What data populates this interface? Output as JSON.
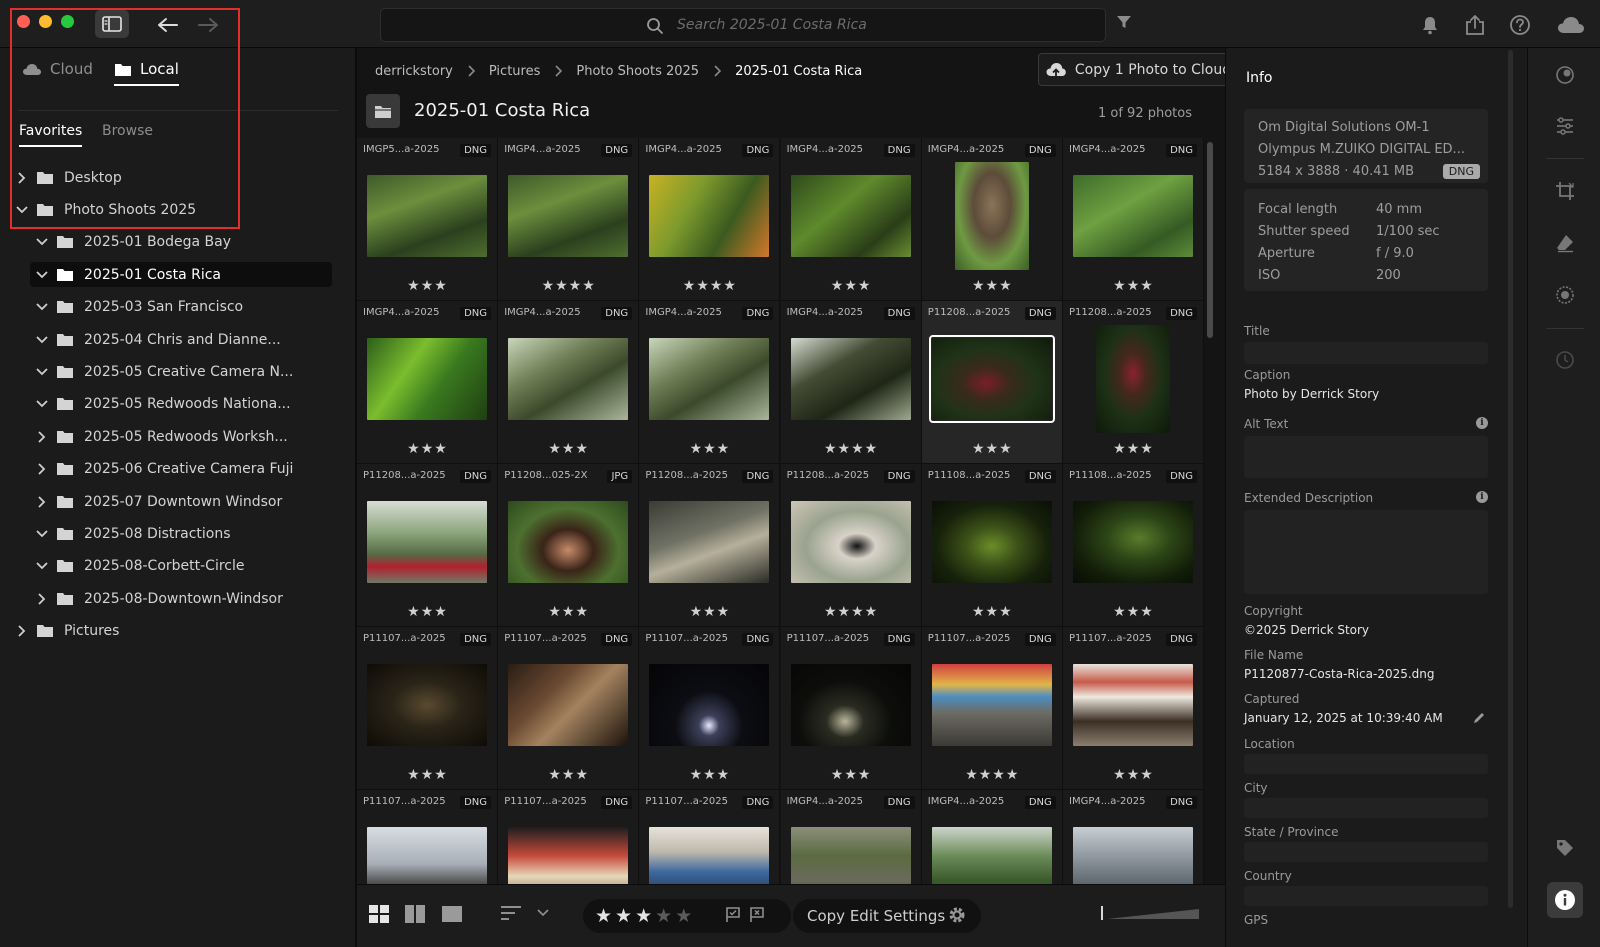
{
  "search": {
    "placeholder": "Search 2025-01 Costa Rica"
  },
  "left_panel": {
    "source_tabs": [
      {
        "label": "Cloud"
      },
      {
        "label": "Local"
      }
    ],
    "sub_tabs": [
      {
        "label": "Favorites"
      },
      {
        "label": "Browse"
      }
    ],
    "folders": [
      {
        "label": "Desktop",
        "level": 0,
        "expanded": false,
        "selected": false
      },
      {
        "label": "Photo Shoots 2025",
        "level": 0,
        "expanded": true,
        "selected": false
      },
      {
        "label": "2025-01 Bodega Bay",
        "level": 1,
        "expanded": true,
        "selected": false
      },
      {
        "label": "2025-01 Costa Rica",
        "level": 1,
        "expanded": true,
        "selected": true
      },
      {
        "label": "2025-03 San Francisco",
        "level": 1,
        "expanded": true,
        "selected": false
      },
      {
        "label": "2025-04 Chris and Dianne...",
        "level": 1,
        "expanded": true,
        "selected": false
      },
      {
        "label": "2025-05 Creative Camera N...",
        "level": 1,
        "expanded": true,
        "selected": false
      },
      {
        "label": "2025-05 Redwoods Nationa...",
        "level": 1,
        "expanded": true,
        "selected": false
      },
      {
        "label": "2025-05 Redwoods Worksh...",
        "level": 1,
        "expanded": false,
        "selected": false
      },
      {
        "label": "2025-06 Creative Camera Fuji",
        "level": 1,
        "expanded": false,
        "selected": false
      },
      {
        "label": "2025-07 Downtown Windsor",
        "level": 1,
        "expanded": false,
        "selected": false
      },
      {
        "label": "2025-08 Distractions",
        "level": 1,
        "expanded": true,
        "selected": false
      },
      {
        "label": "2025-08-Corbett-Circle",
        "level": 1,
        "expanded": true,
        "selected": false
      },
      {
        "label": "2025-08-Downtown-Windsor",
        "level": 1,
        "expanded": false,
        "selected": false
      },
      {
        "label": "Pictures",
        "level": 0,
        "expanded": false,
        "selected": false
      }
    ]
  },
  "breadcrumb": [
    "derrickstory",
    "Pictures",
    "Photo Shoots 2025",
    "2025-01 Costa Rica"
  ],
  "copy_cloud_label": "Copy 1 Photo to Cloud",
  "album": {
    "title": "2025-01 Costa Rica",
    "count": "1 of 92 photos"
  },
  "photos": [
    {
      "name": "IMGP5...a-2025",
      "type": "DNG",
      "stars": "★★★",
      "scene": "bird-branch",
      "tall": false,
      "selected": false
    },
    {
      "name": "IMGP4...a-2025",
      "type": "DNG",
      "stars": "★★★★",
      "scene": "bird-branch",
      "tall": false,
      "selected": false
    },
    {
      "name": "IMGP4...a-2025",
      "type": "DNG",
      "stars": "★★★★",
      "scene": "lizard-yellow",
      "tall": false,
      "selected": false
    },
    {
      "name": "IMGP4...a-2025",
      "type": "DNG",
      "stars": "★★★",
      "scene": "foliage",
      "tall": false,
      "selected": false
    },
    {
      "name": "IMGP4...a-2025",
      "type": "DNG",
      "stars": "★★★",
      "scene": "butterfly-owl",
      "tall": true,
      "selected": false
    },
    {
      "name": "IMGP4...a-2025",
      "type": "DNG",
      "stars": "★★★",
      "scene": "frog-leaf",
      "tall": false,
      "selected": false
    },
    {
      "name": "IMGP4...a-2025",
      "type": "DNG",
      "stars": "★★★",
      "scene": "green-leaf",
      "tall": false,
      "selected": false
    },
    {
      "name": "IMGP4...a-2025",
      "type": "DNG",
      "stars": "★★★",
      "scene": "sloth",
      "tall": false,
      "selected": false
    },
    {
      "name": "IMGP4...a-2025",
      "type": "DNG",
      "stars": "★★★",
      "scene": "sloth",
      "tall": false,
      "selected": false
    },
    {
      "name": "IMGP4...a-2025",
      "type": "DNG",
      "stars": "★★★★",
      "scene": "sloth-dark",
      "tall": false,
      "selected": false
    },
    {
      "name": "P11208...a-2025",
      "type": "DNG",
      "stars": "★★★",
      "scene": "coffee",
      "tall": false,
      "selected": true
    },
    {
      "name": "P11208...a-2025",
      "type": "DNG",
      "stars": "★★★",
      "scene": "coffee-tall",
      "tall": true,
      "selected": false
    },
    {
      "name": "P11208...a-2025",
      "type": "DNG",
      "stars": "★★★",
      "scene": "girl-sitting",
      "tall": false,
      "selected": false
    },
    {
      "name": "P11208...025-2X",
      "type": "JPG",
      "stars": "★★★",
      "scene": "girl-portrait",
      "tall": false,
      "selected": false
    },
    {
      "name": "P11208...a-2025",
      "type": "DNG",
      "stars": "★★★",
      "scene": "man-greenhouse",
      "tall": false,
      "selected": false
    },
    {
      "name": "P11208...a-2025",
      "type": "DNG",
      "stars": "★★★★",
      "scene": "butterfly-hand",
      "tall": false,
      "selected": false
    },
    {
      "name": "P11108...a-2025",
      "type": "DNG",
      "stars": "★★★",
      "scene": "lizard-dark",
      "tall": false,
      "selected": false
    },
    {
      "name": "P11108...a-2025",
      "type": "DNG",
      "stars": "★★★",
      "scene": "frog-dark",
      "tall": false,
      "selected": false
    },
    {
      "name": "P11107...a-2025",
      "type": "DNG",
      "stars": "★★★",
      "scene": "spider-web",
      "tall": false,
      "selected": false
    },
    {
      "name": "P11107...a-2025",
      "type": "DNG",
      "stars": "★★★",
      "scene": "animal-hand",
      "tall": false,
      "selected": false
    },
    {
      "name": "P11107...a-2025",
      "type": "DNG",
      "stars": "★★★",
      "scene": "night-light",
      "tall": false,
      "selected": false
    },
    {
      "name": "P11107...a-2025",
      "type": "DNG",
      "stars": "★★★",
      "scene": "night-dim",
      "tall": false,
      "selected": false
    },
    {
      "name": "P11107...a-2025",
      "type": "DNG",
      "stars": "★★★★",
      "scene": "umbrellas",
      "tall": false,
      "selected": false
    },
    {
      "name": "P11107...a-2025",
      "type": "DNG",
      "stars": "★★★",
      "scene": "storefront",
      "tall": false,
      "selected": false
    },
    {
      "name": "P11107...a-2025",
      "type": "DNG",
      "stars": "",
      "scene": "street-sky",
      "tall": false,
      "selected": false
    },
    {
      "name": "P11107...a-2025",
      "type": "DNG",
      "stars": "",
      "scene": "food-stand",
      "tall": false,
      "selected": false
    },
    {
      "name": "P11107...a-2025",
      "type": "DNG",
      "stars": "",
      "scene": "market",
      "tall": false,
      "selected": false
    },
    {
      "name": "IMGP4...a-2025",
      "type": "DNG",
      "stars": "",
      "scene": "river",
      "tall": false,
      "selected": false
    },
    {
      "name": "IMGP4...a-2025",
      "type": "DNG",
      "stars": "",
      "scene": "palms",
      "tall": false,
      "selected": false
    },
    {
      "name": "IMGP4...a-2025",
      "type": "DNG",
      "stars": "",
      "scene": "crocs",
      "tall": false,
      "selected": false
    }
  ],
  "bottombar": {
    "rating": 3,
    "rating_max": 5,
    "copy_edit_label": "Copy Edit Settings"
  },
  "info": {
    "title": "Info",
    "camera_make": "Om Digital Solutions OM-1",
    "lens": "Olympus M.ZUIKO DIGITAL ED...",
    "dimensions": "5184 x 3888",
    "size": "40.41 MB",
    "badge": "DNG",
    "exif": [
      {
        "label": "Focal length",
        "value": "40 mm"
      },
      {
        "label": "Shutter speed",
        "value": "1/100 sec"
      },
      {
        "label": "Aperture",
        "value": "f / 9.0"
      },
      {
        "label": "ISO",
        "value": "200"
      }
    ],
    "fields": {
      "title_label": "Title",
      "caption_label": "Caption",
      "caption_value": "Photo by Derrick Story",
      "alt_text_label": "Alt Text",
      "ext_desc_label": "Extended Description",
      "copyright_label": "Copyright",
      "copyright_value": "©2025 Derrick Story",
      "file_name_label": "File Name",
      "file_name_value": "P1120877-Costa-Rica-2025.dng",
      "captured_label": "Captured",
      "captured_value": "January 12, 2025 at 10:39:40 AM",
      "location_label": "Location",
      "city_label": "City",
      "state_label": "State / Province",
      "country_label": "Country",
      "gps_label": "GPS"
    }
  },
  "colors": {
    "annotation": "#e0302b",
    "accent": "#ffffff",
    "panel": "#1b1b1b"
  }
}
